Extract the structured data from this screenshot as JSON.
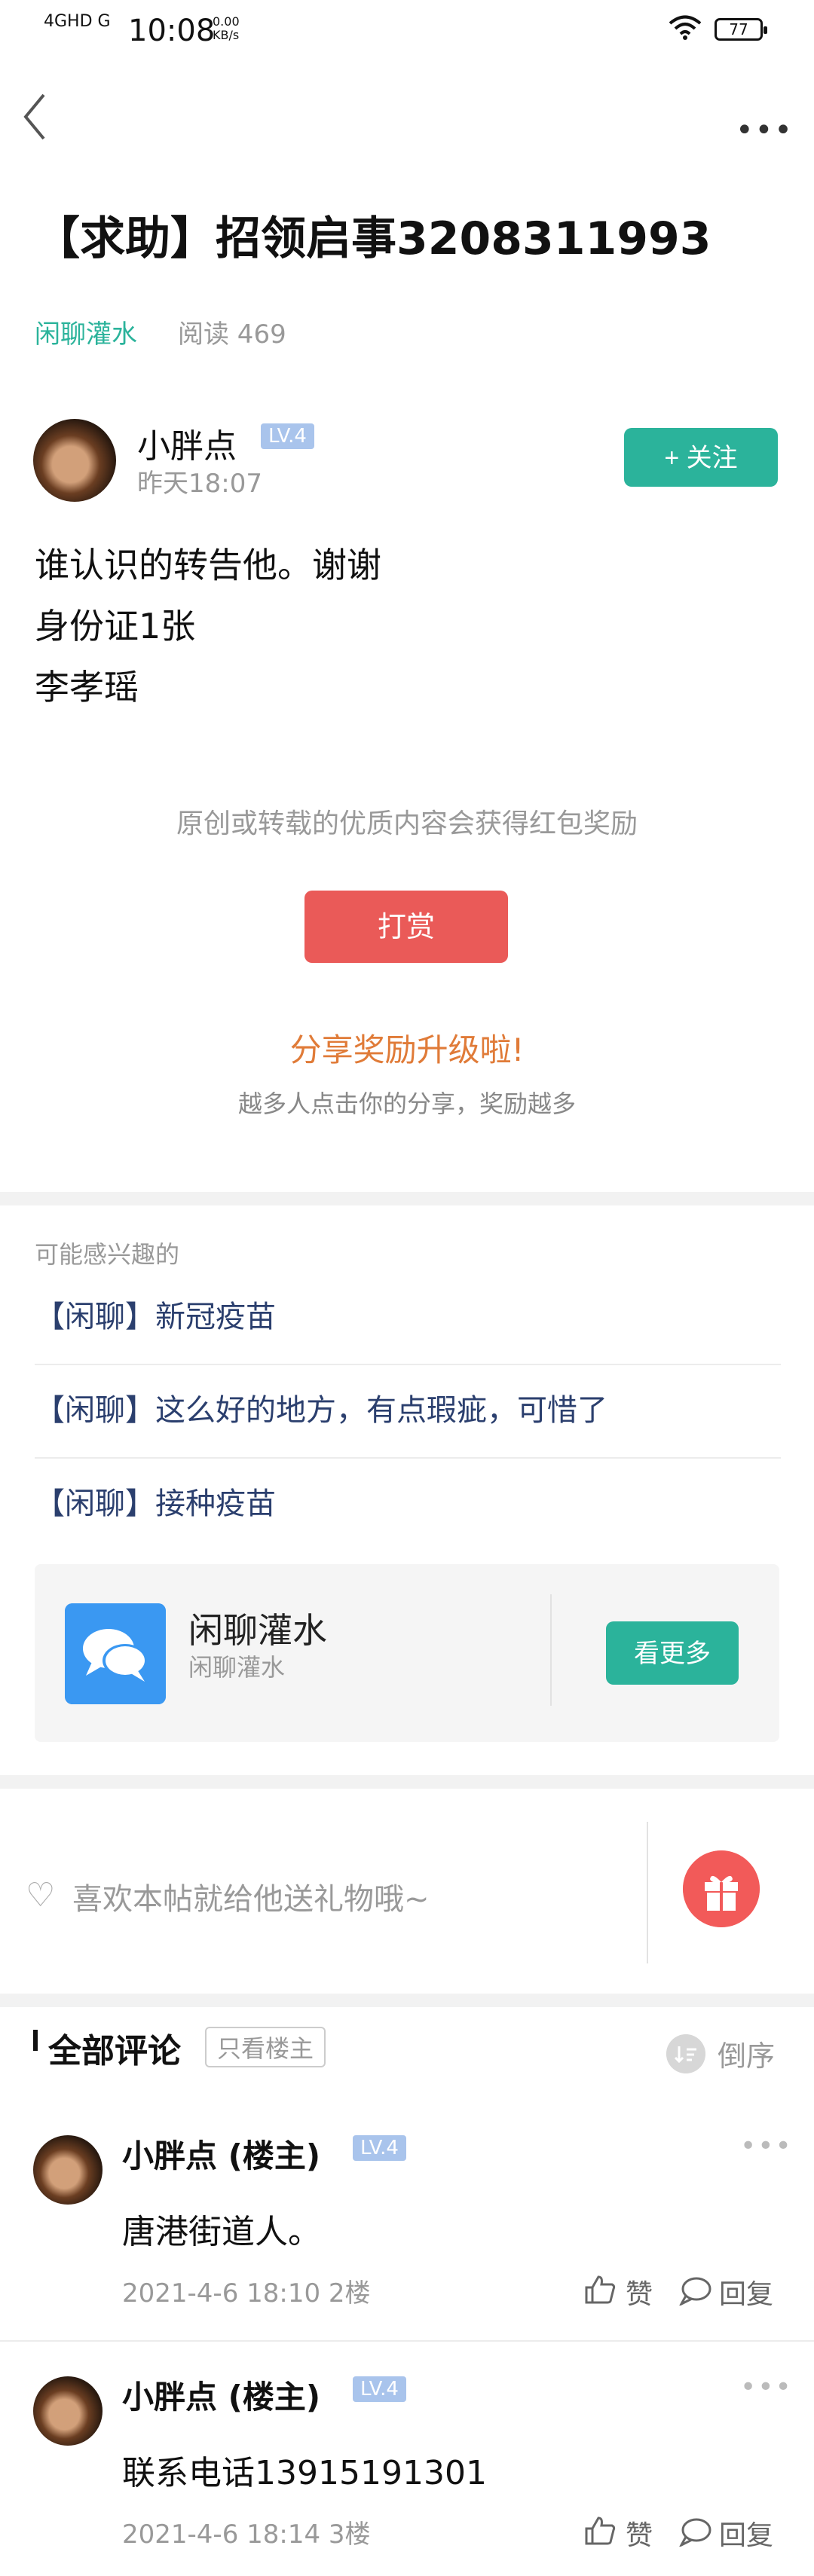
{
  "status_bar": {
    "network": "4GHD G",
    "time": "10:08",
    "speed_value": "0.00",
    "speed_unit": "KB/s",
    "battery": "77"
  },
  "post": {
    "title": "【求助】招领启事3208311993",
    "forum_tag": "闲聊灌水",
    "reads_label": "阅读 469",
    "author": "小胖点",
    "level": "LV.4",
    "time": "昨天18:07",
    "follow_label": "+ 关注",
    "content": [
      "谁认识的转告他。谢谢",
      "身份证1张",
      "李孝瑶"
    ]
  },
  "reward": {
    "tip_text": "原创或转载的优质内容会获得红包奖励",
    "button": "打赏",
    "share_title": "分享奖励升级啦!",
    "share_sub": "越多人点击你的分享，奖励越多"
  },
  "interest": {
    "label": "可能感兴趣的",
    "items": [
      "【闲聊】新冠疫苗",
      "【闲聊】这么好的地方，有点瑕疵，可惜了",
      "【闲聊】接种疫苗"
    ]
  },
  "forum_card": {
    "title": "闲聊灌水",
    "subtitle": "闲聊灌水",
    "button": "看更多"
  },
  "gift": {
    "text": "喜欢本帖就给他送礼物哦~"
  },
  "comments": {
    "title": "全部评论",
    "only_op": "只看楼主",
    "sort": "倒序",
    "items": [
      {
        "name": "小胖点 (楼主)",
        "level": "LV.4",
        "text": "唐港街道人。",
        "meta": "2021-4-6 18:10  2楼",
        "like": "赞",
        "reply": "回复"
      },
      {
        "name": "小胖点 (楼主)",
        "level": "LV.4",
        "text": "联系电话13915191301",
        "meta": "2021-4-6 18:14  3楼",
        "like": "赞",
        "reply": "回复"
      }
    ]
  }
}
